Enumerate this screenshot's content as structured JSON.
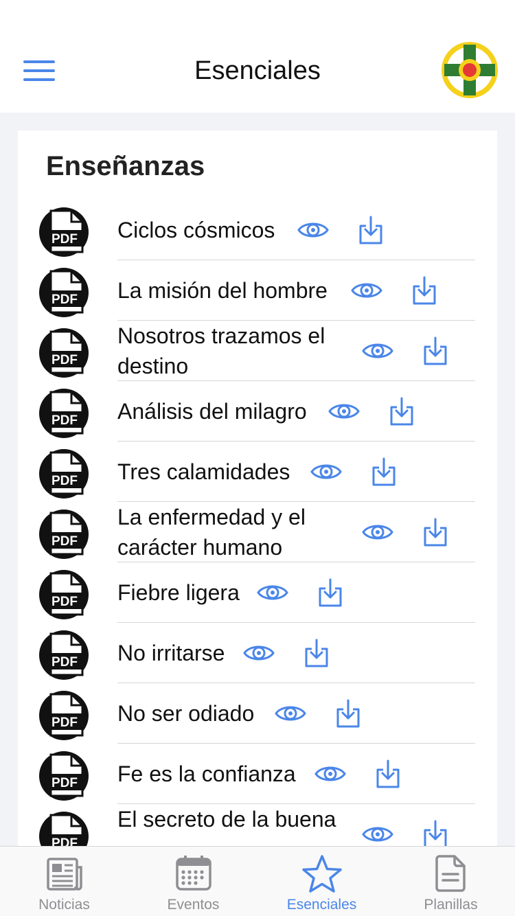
{
  "header": {
    "title": "Esenciales"
  },
  "section": {
    "title": "Enseñanzas"
  },
  "items": [
    {
      "title": "Ciclos cósmicos"
    },
    {
      "title": "La misión del hombre"
    },
    {
      "title": "Nosotros trazamos el destino"
    },
    {
      "title": "Análisis del milagro"
    },
    {
      "title": "Tres calamidades"
    },
    {
      "title": "La enfermedad y el carácter humano"
    },
    {
      "title": "Fiebre ligera"
    },
    {
      "title": "No irritarse"
    },
    {
      "title": "No ser odiado"
    },
    {
      "title": "Fe es la confianza"
    },
    {
      "title": "El secreto de la buena"
    }
  ],
  "pdf_badge": "PDF",
  "tabs": [
    {
      "label": "Noticias",
      "icon": "newspaper-icon"
    },
    {
      "label": "Eventos",
      "icon": "calendar-icon"
    },
    {
      "label": "Esenciales",
      "icon": "star-icon",
      "active": true
    },
    {
      "label": "Planillas",
      "icon": "document-icon"
    }
  ],
  "colors": {
    "accent": "#4a86e8",
    "inactive": "#8e8e93",
    "logo_green": "#2e7d32",
    "logo_yellow": "#f5d11c",
    "logo_red": "#e53935"
  }
}
